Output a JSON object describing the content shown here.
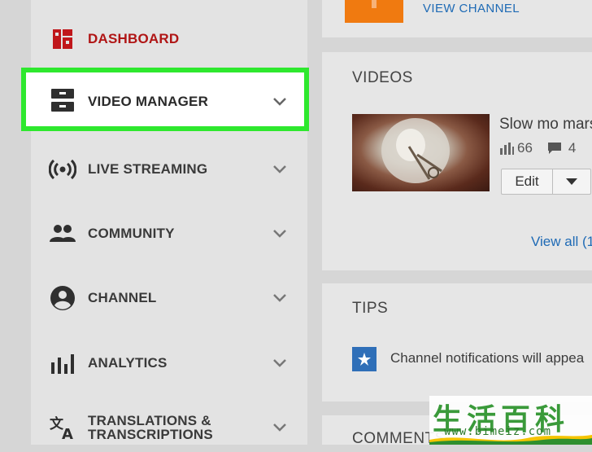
{
  "sidebar": {
    "items": [
      {
        "label": "DASHBOARD",
        "icon": "dashboard-icon",
        "active": true
      },
      {
        "label": "VIDEO MANAGER",
        "icon": "video-manager-icon",
        "highlighted": true
      },
      {
        "label": "LIVE STREAMING",
        "icon": "live-streaming-icon"
      },
      {
        "label": "COMMUNITY",
        "icon": "community-icon"
      },
      {
        "label": "CHANNEL",
        "icon": "channel-icon"
      },
      {
        "label": "ANALYTICS",
        "icon": "analytics-icon"
      },
      {
        "label": "TRANSLATIONS &",
        "label_line2": "TRANSCRIPTIONS",
        "icon": "translate-icon"
      }
    ]
  },
  "header": {
    "view_channel": "VIEW CHANNEL"
  },
  "videos_card": {
    "title": "VIDEOS",
    "video_title": "Slow mo mars",
    "views": "66",
    "comments": "4",
    "edit_label": "Edit",
    "view_all": "View all (1"
  },
  "tips_card": {
    "title": "TIPS",
    "tip_text": "Channel notifications will appea"
  },
  "comments_card": {
    "title": "COMMENTS"
  },
  "watermark": {
    "chars": "生活百科",
    "url": "www.bimeiz.com"
  },
  "colors": {
    "highlight": "#2ee82e",
    "active": "#b01515",
    "link": "#1e6ab5",
    "upload_orange": "#ff7a00"
  }
}
